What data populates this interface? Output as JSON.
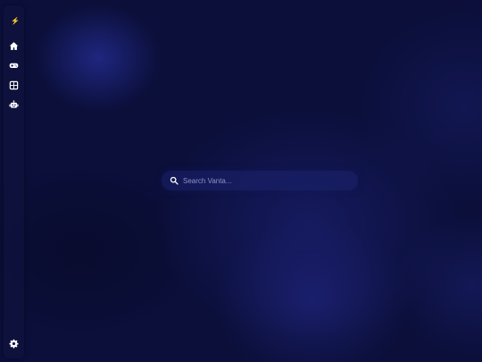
{
  "sidebar": {
    "logo": "⚡",
    "items": [
      {
        "name": "home",
        "icon": "home-icon"
      },
      {
        "name": "games",
        "icon": "gamepad-icon"
      },
      {
        "name": "apps",
        "icon": "grid-icon"
      },
      {
        "name": "ai",
        "icon": "robot-icon"
      }
    ],
    "settings_icon": "gear-icon"
  },
  "search": {
    "placeholder": "Search Vanta...",
    "value": ""
  },
  "colors": {
    "background": "#0b0f3a",
    "accent": "#262e96",
    "icon": "#ffffff"
  }
}
